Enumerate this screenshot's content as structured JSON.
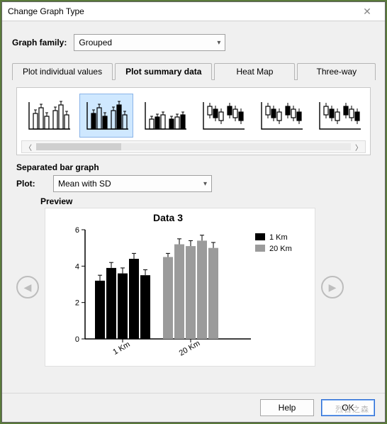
{
  "window": {
    "title": "Change Graph Type"
  },
  "family": {
    "label": "Graph family:",
    "value": "Grouped"
  },
  "tabs": [
    {
      "label": "Plot individual values"
    },
    {
      "label": "Plot summary data"
    },
    {
      "label": "Heat Map"
    },
    {
      "label": "Three-way"
    }
  ],
  "active_tab": 1,
  "graphtype": {
    "title": "Separated bar graph"
  },
  "plot": {
    "label": "Plot:",
    "value": "Mean with SD"
  },
  "preview": {
    "label": "Preview"
  },
  "footer": {
    "help": "Help",
    "ok": "OK"
  },
  "watermark": "烈日之森",
  "chart_data": {
    "type": "bar",
    "title": "Data 3",
    "ylabel": "",
    "xlabel": "",
    "ylim": [
      0,
      6
    ],
    "yticks": [
      0,
      2,
      4,
      6
    ],
    "categories": [
      "1 Km",
      "20 Km"
    ],
    "series": [
      {
        "name": "1 Km",
        "color": "#000000",
        "values": [
          3.2,
          3.9,
          3.6,
          4.4,
          3.5
        ],
        "err": [
          0.3,
          0.3,
          0.3,
          0.3,
          0.3
        ]
      },
      {
        "name": "20 Km",
        "color": "#9b9b9b",
        "values": [
          4.5,
          5.2,
          5.1,
          5.4,
          5.0
        ],
        "err": [
          0.2,
          0.3,
          0.3,
          0.3,
          0.3
        ]
      }
    ],
    "legend": [
      "1 Km",
      "20 Km"
    ]
  }
}
